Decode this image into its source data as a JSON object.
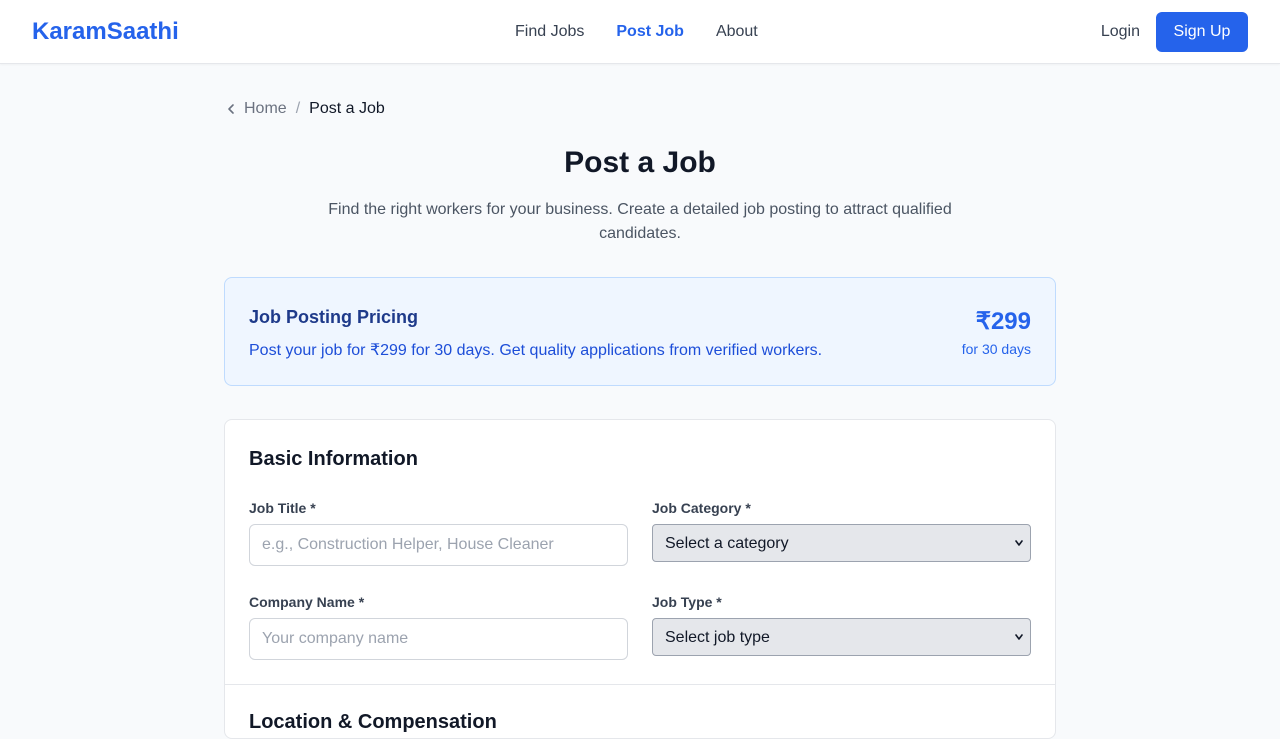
{
  "nav": {
    "logo": "KaramSaathi",
    "links": [
      "Find Jobs",
      "Post Job",
      "About"
    ],
    "login": "Login",
    "signup": "Sign Up"
  },
  "breadcrumb": {
    "home": "Home",
    "separator": "/",
    "current": "Post a Job"
  },
  "page": {
    "title": "Post a Job",
    "subtitle": "Find the right workers for your business. Create a detailed job posting to attract qualified candidates."
  },
  "pricing": {
    "title": "Job Posting Pricing",
    "description": "Post your job for ₹299 for 30 days. Get quality applications from verified workers.",
    "price": "₹299",
    "duration": "for 30 days"
  },
  "form": {
    "section1_title": "Basic Information",
    "job_title_label": "Job Title *",
    "job_title_placeholder": "e.g., Construction Helper, House Cleaner",
    "category_label": "Job Category *",
    "category_value": "Select a category",
    "company_label": "Company Name *",
    "company_placeholder": "Your company name",
    "job_type_label": "Job Type *",
    "job_type_value": "Select job type",
    "section2_title": "Location & Compensation"
  },
  "colors": {
    "brand": "#2563eb",
    "pricing_bg": "#eff6ff",
    "pricing_border": "#bfdbfe"
  }
}
